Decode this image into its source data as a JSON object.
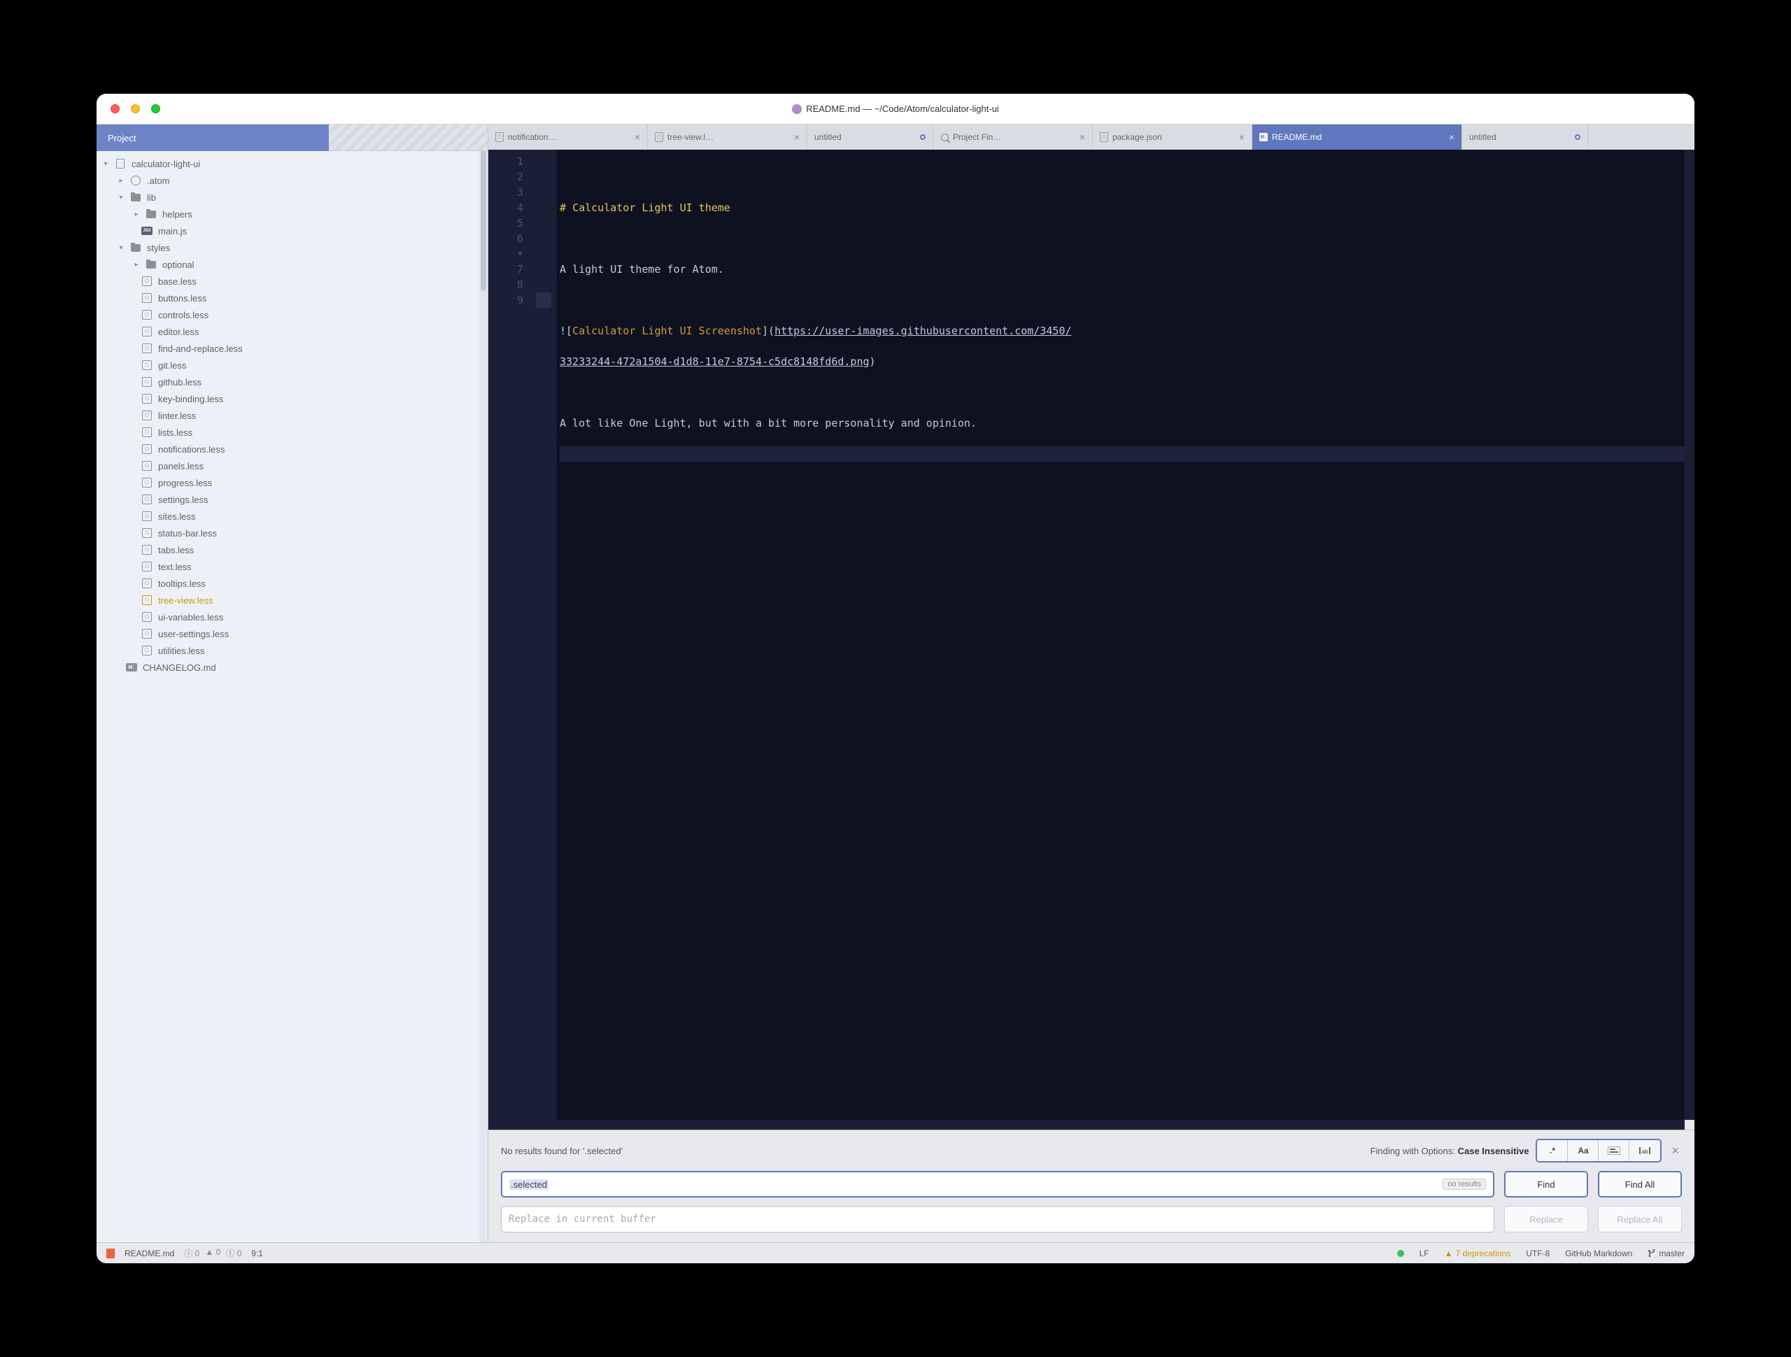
{
  "window_title": "README.md — ~/Code/Atom/calculator-light-ui",
  "sidebar": {
    "tab_label": "Project",
    "root": "calculator-light-ui",
    "atom_folder": ".atom",
    "lib_folder": "lib",
    "helpers_folder": "helpers",
    "mainjs": "main.js",
    "styles_folder": "styles",
    "optional_folder": "optional",
    "files": {
      "base": "base.less",
      "buttons": "buttons.less",
      "controls": "controls.less",
      "editor": "editor.less",
      "find": "find-and-replace.less",
      "git": "git.less",
      "github": "github.less",
      "keybinding": "key-binding.less",
      "linter": "linter.less",
      "lists": "lists.less",
      "notifications": "notifications.less",
      "panels": "panels.less",
      "progress": "progress.less",
      "settings": "settings.less",
      "sites": "sites.less",
      "statusbar": "status-bar.less",
      "tabs": "tabs.less",
      "text": "text.less",
      "tooltips": "tooltips.less",
      "treeview": "tree-view.less",
      "uivars": "ui-variables.less",
      "usersettings": "user-settings.less",
      "utilities": "utilities.less"
    },
    "changelog": "CHANGELOG.md"
  },
  "tabs": {
    "t0": "notification…",
    "t1": "tree-view.l…",
    "t2": "untitled",
    "t3": "Project Fin…",
    "t4": "package.json",
    "t5": "README.md",
    "t6": "untitled"
  },
  "editor": {
    "lines": {
      "l1": "",
      "l2_head": "# Calculator Light UI theme",
      "l3": "",
      "l4": "A light UI theme for Atom.",
      "l5": "",
      "l6_pre": "![",
      "l6_alt": "Calculator Light UI Screenshot",
      "l6_mid": "](",
      "l6_url_a": "https://user-images.githubusercontent.com/3450/",
      "l6_url_b": "33233244-472a1504-d1d8-11e7-8754-c5dc8148fd6d.png",
      "l6_post": ")",
      "l7": "",
      "l8": "A lot like One Light, but with a bit more personality and opinion.",
      "l9": ""
    },
    "gutter": {
      "n1": "1",
      "n2": "2",
      "n3": "3",
      "n4": "4",
      "n5": "5",
      "n6": "6",
      "dot": "•",
      "n7": "7",
      "n8": "8",
      "n9": "9"
    }
  },
  "find": {
    "status": "No results found for '.selected'",
    "opts_label_pre": "Finding with Options: ",
    "opts_label_b": "Case Insensitive",
    "input_value": ".selected",
    "no_results_badge": "no results",
    "replace_placeholder": "Replace in current buffer",
    "btn_find": "Find",
    "btn_find_all": "Find All",
    "btn_replace": "Replace",
    "btn_replace_all": "Replace All",
    "opt_regex": ".*",
    "opt_case": "Aa"
  },
  "status": {
    "filename": "README.md",
    "diagnostics_i": "ⓘ 0",
    "diagnostics_w": "▲ 0",
    "diagnostics_e": "Ⓘ 0",
    "cursor": "9:1",
    "line_ending": "LF",
    "deprecations": "7 deprecations",
    "encoding": "UTF-8",
    "grammar": "GitHub Markdown",
    "branch": "master"
  }
}
